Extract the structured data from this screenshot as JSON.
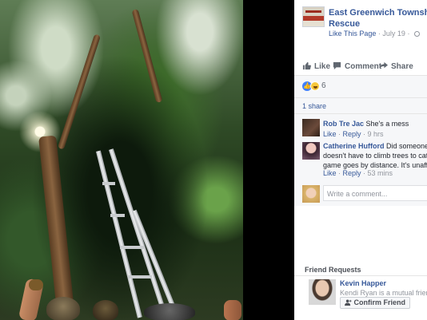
{
  "post": {
    "page_name": "East Greenwich Township Fire Rescue",
    "like_page": "Like This Page",
    "dot": "·",
    "date": "July 19",
    "dot2": "·"
  },
  "actions": {
    "like": "Like",
    "comment": "Comment",
    "share": "Share"
  },
  "reactions": {
    "count": "6"
  },
  "shares": "1 share",
  "comments": [
    {
      "author": "Rob Tre Jac",
      "text": "She's a mess",
      "like": "Like",
      "reply": "Reply",
      "time": "9 hrs"
    },
    {
      "author": "Catherine Hufford",
      "text": "Did someone tell",
      "line2": "doesn't have to climb trees to catch P",
      "line3": "game goes by distance. It's unaffecte",
      "like": "Like",
      "reply": "Reply",
      "time": "53 mins"
    }
  ],
  "write_comment": {
    "placeholder": "Write a comment..."
  },
  "friend_requests": {
    "title": "Friend Requests",
    "name": "Kevin Happer",
    "mutual": "Kendi Ryan is a mutual friend.",
    "confirm": "Confirm Friend"
  }
}
